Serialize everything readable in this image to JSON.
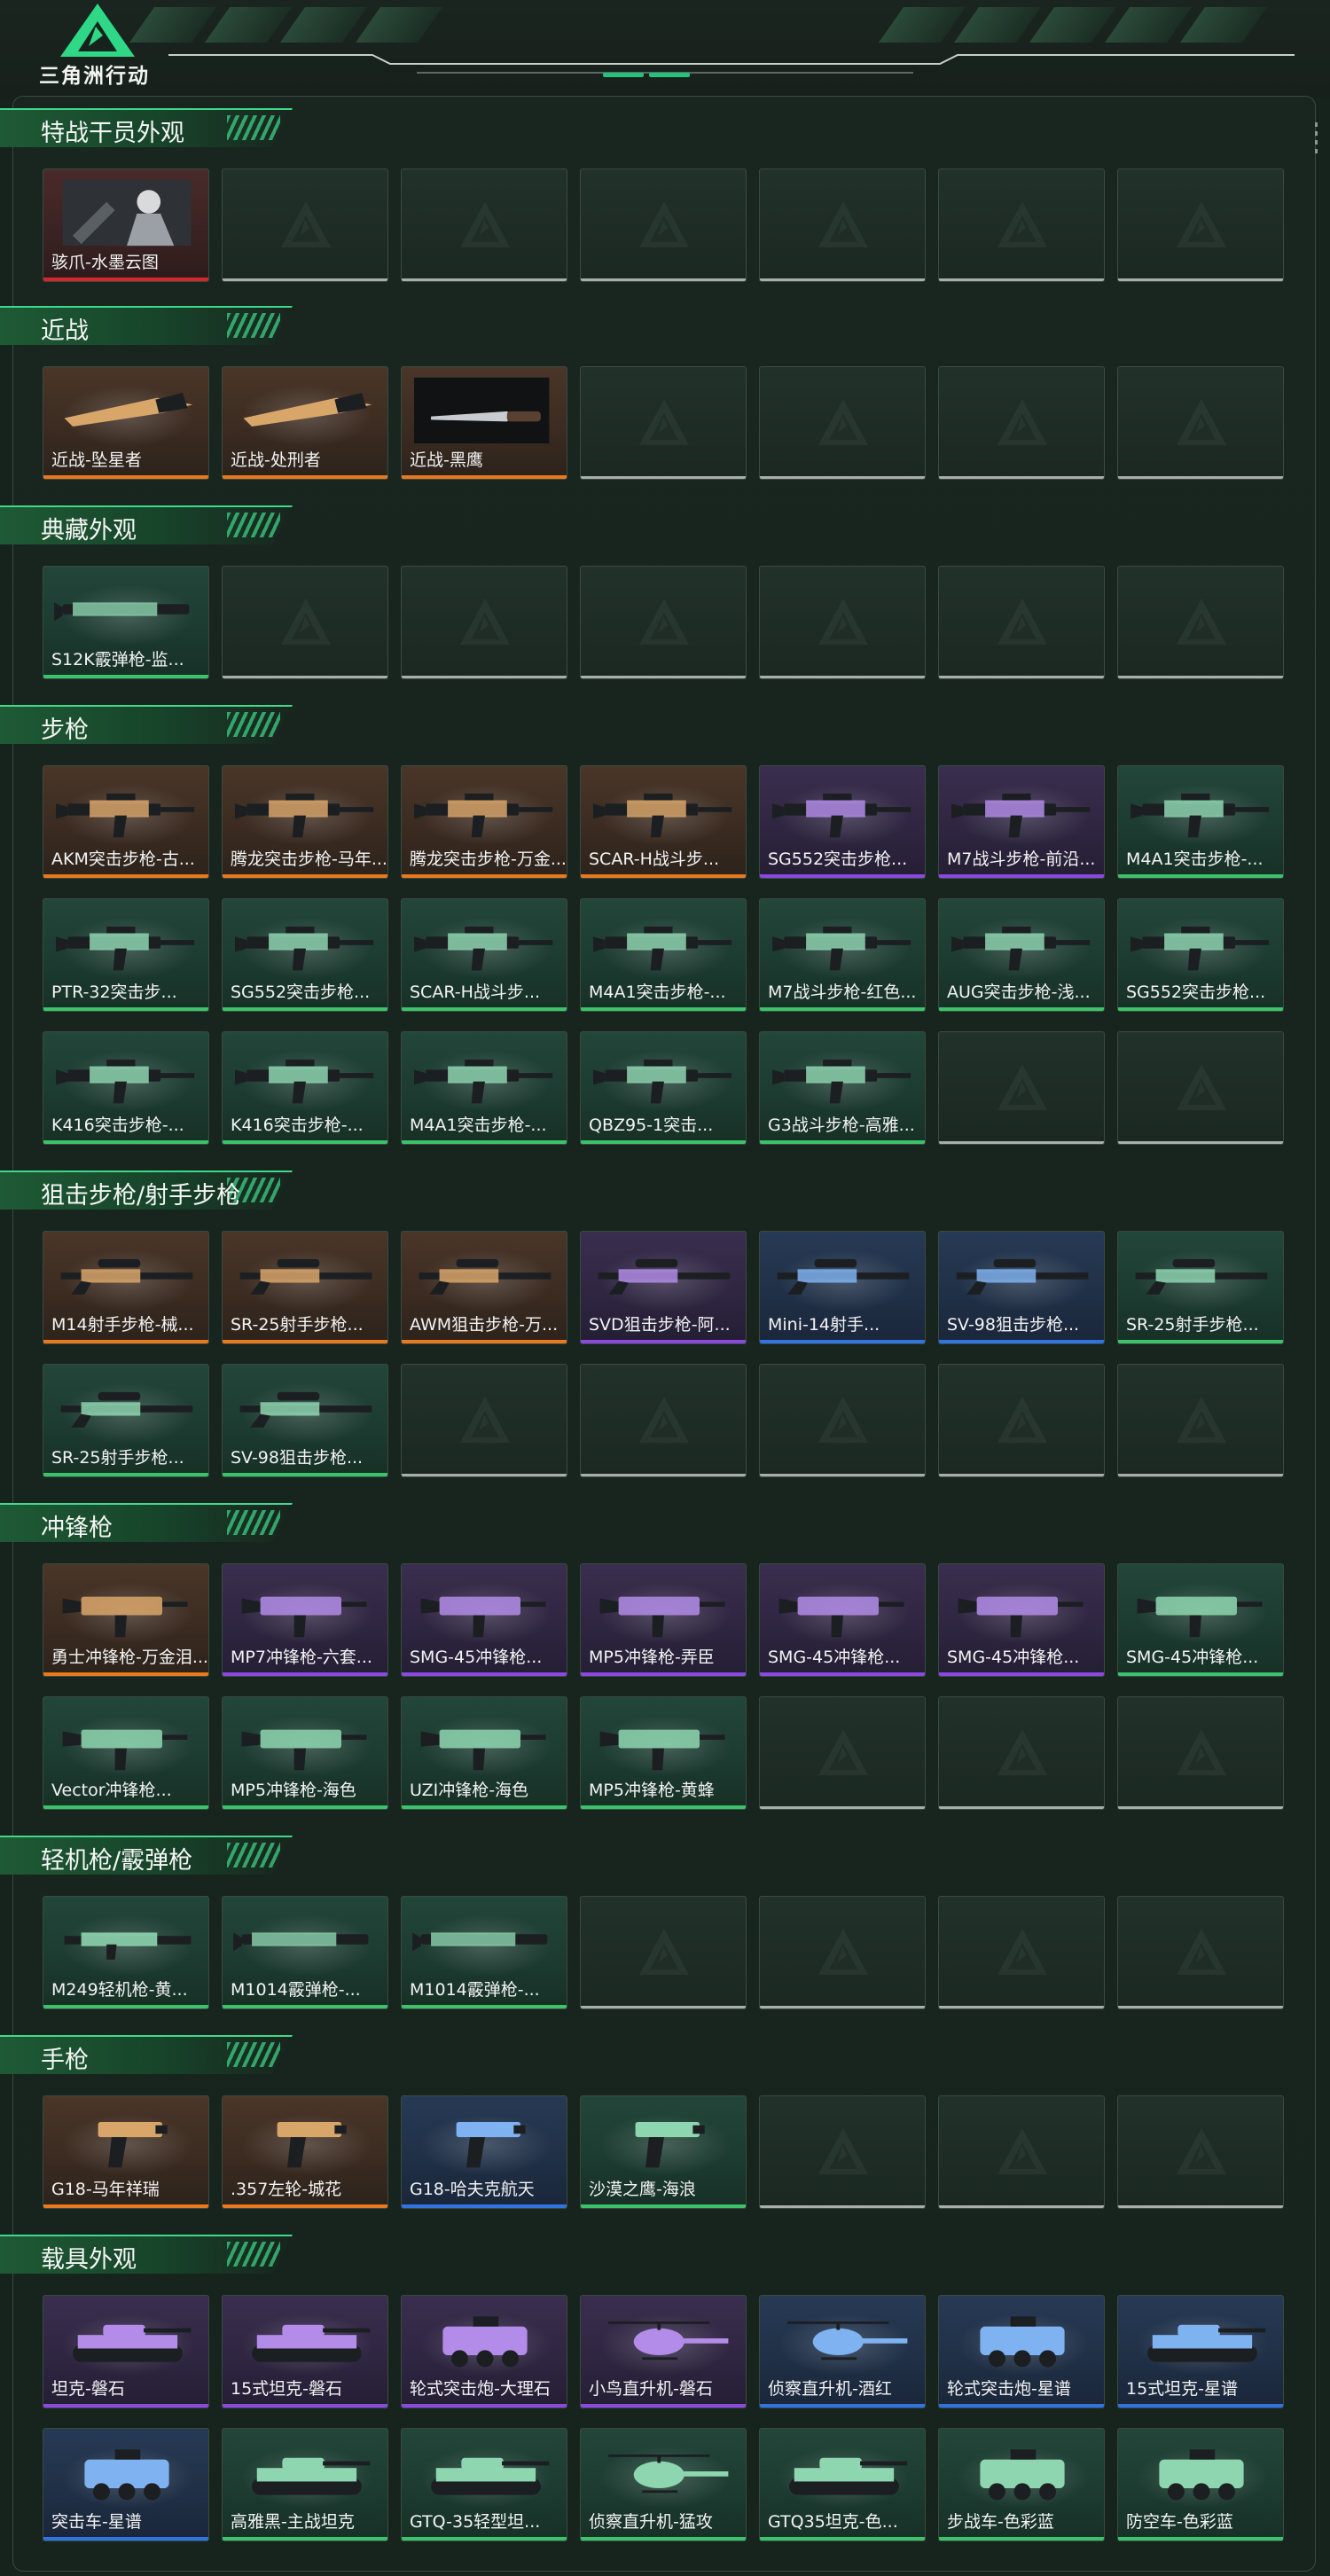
{
  "header": {
    "game_title": "三角洲行动",
    "logo": "delta-triangle-logo"
  },
  "colors": {
    "background": "#16221c",
    "accent": "#3fd98a",
    "rarity_orange": "#e8791f",
    "rarity_purple": "#8a4ae0",
    "rarity_blue": "#2f74e0",
    "rarity_green": "#3bc26a",
    "rarity_red": "#d8252c",
    "empty_slot": "#a8aeaa"
  },
  "sections": [
    {
      "title": "特战干员外观",
      "items": [
        {
          "label": "骇爪-水墨云图",
          "rarity": "red",
          "icon": "operator-portrait",
          "art_text": "水墨云图"
        }
      ],
      "slots": 7
    },
    {
      "title": "近战",
      "items": [
        {
          "label": "近战-坠星者",
          "rarity": "orange",
          "icon": "melee-blade"
        },
        {
          "label": "近战-处刑者",
          "rarity": "orange",
          "icon": "melee-blade"
        },
        {
          "label": "近战-黑鹰",
          "rarity": "orange",
          "icon": "melee-knife"
        }
      ],
      "slots": 7
    },
    {
      "title": "典藏外观",
      "items": [
        {
          "label": "S12K霰弹枪-监...",
          "rarity": "green",
          "icon": "shotgun"
        }
      ],
      "slots": 7
    },
    {
      "title": "步枪",
      "items": [
        {
          "label": "AKM突击步枪-古...",
          "rarity": "orange",
          "icon": "rifle"
        },
        {
          "label": "腾龙突击步枪-马年...",
          "rarity": "orange",
          "icon": "rifle"
        },
        {
          "label": "腾龙突击步枪-万金...",
          "rarity": "orange",
          "icon": "rifle"
        },
        {
          "label": "SCAR-H战斗步...",
          "rarity": "orange",
          "icon": "rifle"
        },
        {
          "label": "SG552突击步枪...",
          "rarity": "purple",
          "icon": "rifle"
        },
        {
          "label": "M7战斗步枪-前沿...",
          "rarity": "purple",
          "icon": "rifle"
        },
        {
          "label": "M4A1突击步枪-...",
          "rarity": "green",
          "icon": "rifle"
        },
        {
          "label": "PTR-32突击步...",
          "rarity": "green",
          "icon": "rifle"
        },
        {
          "label": "SG552突击步枪...",
          "rarity": "green",
          "icon": "rifle"
        },
        {
          "label": "SCAR-H战斗步...",
          "rarity": "green",
          "icon": "rifle"
        },
        {
          "label": "M4A1突击步枪-...",
          "rarity": "green",
          "icon": "rifle"
        },
        {
          "label": "M7战斗步枪-红色...",
          "rarity": "green",
          "icon": "rifle"
        },
        {
          "label": "AUG突击步枪-浅...",
          "rarity": "green",
          "icon": "rifle"
        },
        {
          "label": "SG552突击步枪...",
          "rarity": "green",
          "icon": "rifle"
        },
        {
          "label": "K416突击步枪-...",
          "rarity": "green",
          "icon": "rifle"
        },
        {
          "label": "K416突击步枪-...",
          "rarity": "green",
          "icon": "rifle"
        },
        {
          "label": "M4A1突击步枪-...",
          "rarity": "green",
          "icon": "rifle"
        },
        {
          "label": "QBZ95-1突击...",
          "rarity": "green",
          "icon": "rifle"
        },
        {
          "label": "G3战斗步枪-高雅...",
          "rarity": "green",
          "icon": "rifle"
        }
      ],
      "slots": 21
    },
    {
      "title": "狙击步枪/射手步枪",
      "items": [
        {
          "label": "M14射手步枪-械...",
          "rarity": "orange",
          "icon": "sniper"
        },
        {
          "label": "SR-25射手步枪...",
          "rarity": "orange",
          "icon": "sniper"
        },
        {
          "label": "AWM狙击步枪-万...",
          "rarity": "orange",
          "icon": "sniper"
        },
        {
          "label": "SVD狙击步枪-阿...",
          "rarity": "purple",
          "icon": "sniper"
        },
        {
          "label": "Mini-14射手...",
          "rarity": "blue",
          "icon": "sniper"
        },
        {
          "label": "SV-98狙击步枪...",
          "rarity": "blue",
          "icon": "sniper"
        },
        {
          "label": "SR-25射手步枪...",
          "rarity": "green",
          "icon": "sniper"
        },
        {
          "label": "SR-25射手步枪...",
          "rarity": "green",
          "icon": "sniper"
        },
        {
          "label": "SV-98狙击步枪...",
          "rarity": "green",
          "icon": "sniper"
        }
      ],
      "slots": 14
    },
    {
      "title": "冲锋枪",
      "items": [
        {
          "label": "勇士冲锋枪-万金泪...",
          "rarity": "orange",
          "icon": "smg"
        },
        {
          "label": "MP7冲锋枪-六套...",
          "rarity": "purple",
          "icon": "smg"
        },
        {
          "label": "SMG-45冲锋枪...",
          "rarity": "purple",
          "icon": "smg"
        },
        {
          "label": "MP5冲锋枪-弄臣",
          "rarity": "purple",
          "icon": "smg"
        },
        {
          "label": "SMG-45冲锋枪...",
          "rarity": "purple",
          "icon": "smg"
        },
        {
          "label": "SMG-45冲锋枪...",
          "rarity": "purple",
          "icon": "smg"
        },
        {
          "label": "SMG-45冲锋枪...",
          "rarity": "green",
          "icon": "smg"
        },
        {
          "label": "Vector冲锋枪...",
          "rarity": "green",
          "icon": "smg"
        },
        {
          "label": "MP5冲锋枪-海色",
          "rarity": "green",
          "icon": "smg"
        },
        {
          "label": "UZI冲锋枪-海色",
          "rarity": "green",
          "icon": "smg"
        },
        {
          "label": "MP5冲锋枪-黄蜂",
          "rarity": "green",
          "icon": "smg"
        }
      ],
      "slots": 14
    },
    {
      "title": "轻机枪/霰弹枪",
      "items": [
        {
          "label": "M249轻机枪-黄...",
          "rarity": "green",
          "icon": "lmg"
        },
        {
          "label": "M1014霰弹枪-...",
          "rarity": "green",
          "icon": "shotgun"
        },
        {
          "label": "M1014霰弹枪-...",
          "rarity": "green",
          "icon": "shotgun"
        }
      ],
      "slots": 7
    },
    {
      "title": "手枪",
      "items": [
        {
          "label": "G18-马年祥瑞",
          "rarity": "orange",
          "icon": "pistol"
        },
        {
          "label": ".357左轮-城花",
          "rarity": "orange",
          "icon": "pistol"
        },
        {
          "label": "G18-哈夫克航天",
          "rarity": "blue",
          "icon": "pistol"
        },
        {
          "label": "沙漠之鹰-海浪",
          "rarity": "green",
          "icon": "pistol"
        }
      ],
      "slots": 7
    },
    {
      "title": "载具外观",
      "items": [
        {
          "label": "坦克-磐石",
          "rarity": "purple",
          "icon": "tank"
        },
        {
          "label": "15式坦克-磐石",
          "rarity": "purple",
          "icon": "tank"
        },
        {
          "label": "轮式突击炮-大理石",
          "rarity": "purple",
          "icon": "armored-car"
        },
        {
          "label": "小鸟直升机-磐石",
          "rarity": "purple",
          "icon": "helicopter"
        },
        {
          "label": "侦察直升机-酒红",
          "rarity": "blue",
          "icon": "helicopter"
        },
        {
          "label": "轮式突击炮-星谱",
          "rarity": "blue",
          "icon": "armored-car"
        },
        {
          "label": "15式坦克-星谱",
          "rarity": "blue",
          "icon": "tank"
        },
        {
          "label": "突击车-星谱",
          "rarity": "blue",
          "icon": "armored-car"
        },
        {
          "label": "高雅黑-主战坦克",
          "rarity": "green",
          "icon": "tank"
        },
        {
          "label": "GTQ-35轻型坦...",
          "rarity": "green",
          "icon": "tank"
        },
        {
          "label": "侦察直升机-猛攻",
          "rarity": "green",
          "icon": "helicopter"
        },
        {
          "label": "GTQ35坦克-色...",
          "rarity": "green",
          "icon": "tank"
        },
        {
          "label": "步战车-色彩蓝",
          "rarity": "green",
          "icon": "armored-car"
        },
        {
          "label": "防空车-色彩蓝",
          "rarity": "green",
          "icon": "armored-car"
        }
      ],
      "slots": 14
    }
  ]
}
